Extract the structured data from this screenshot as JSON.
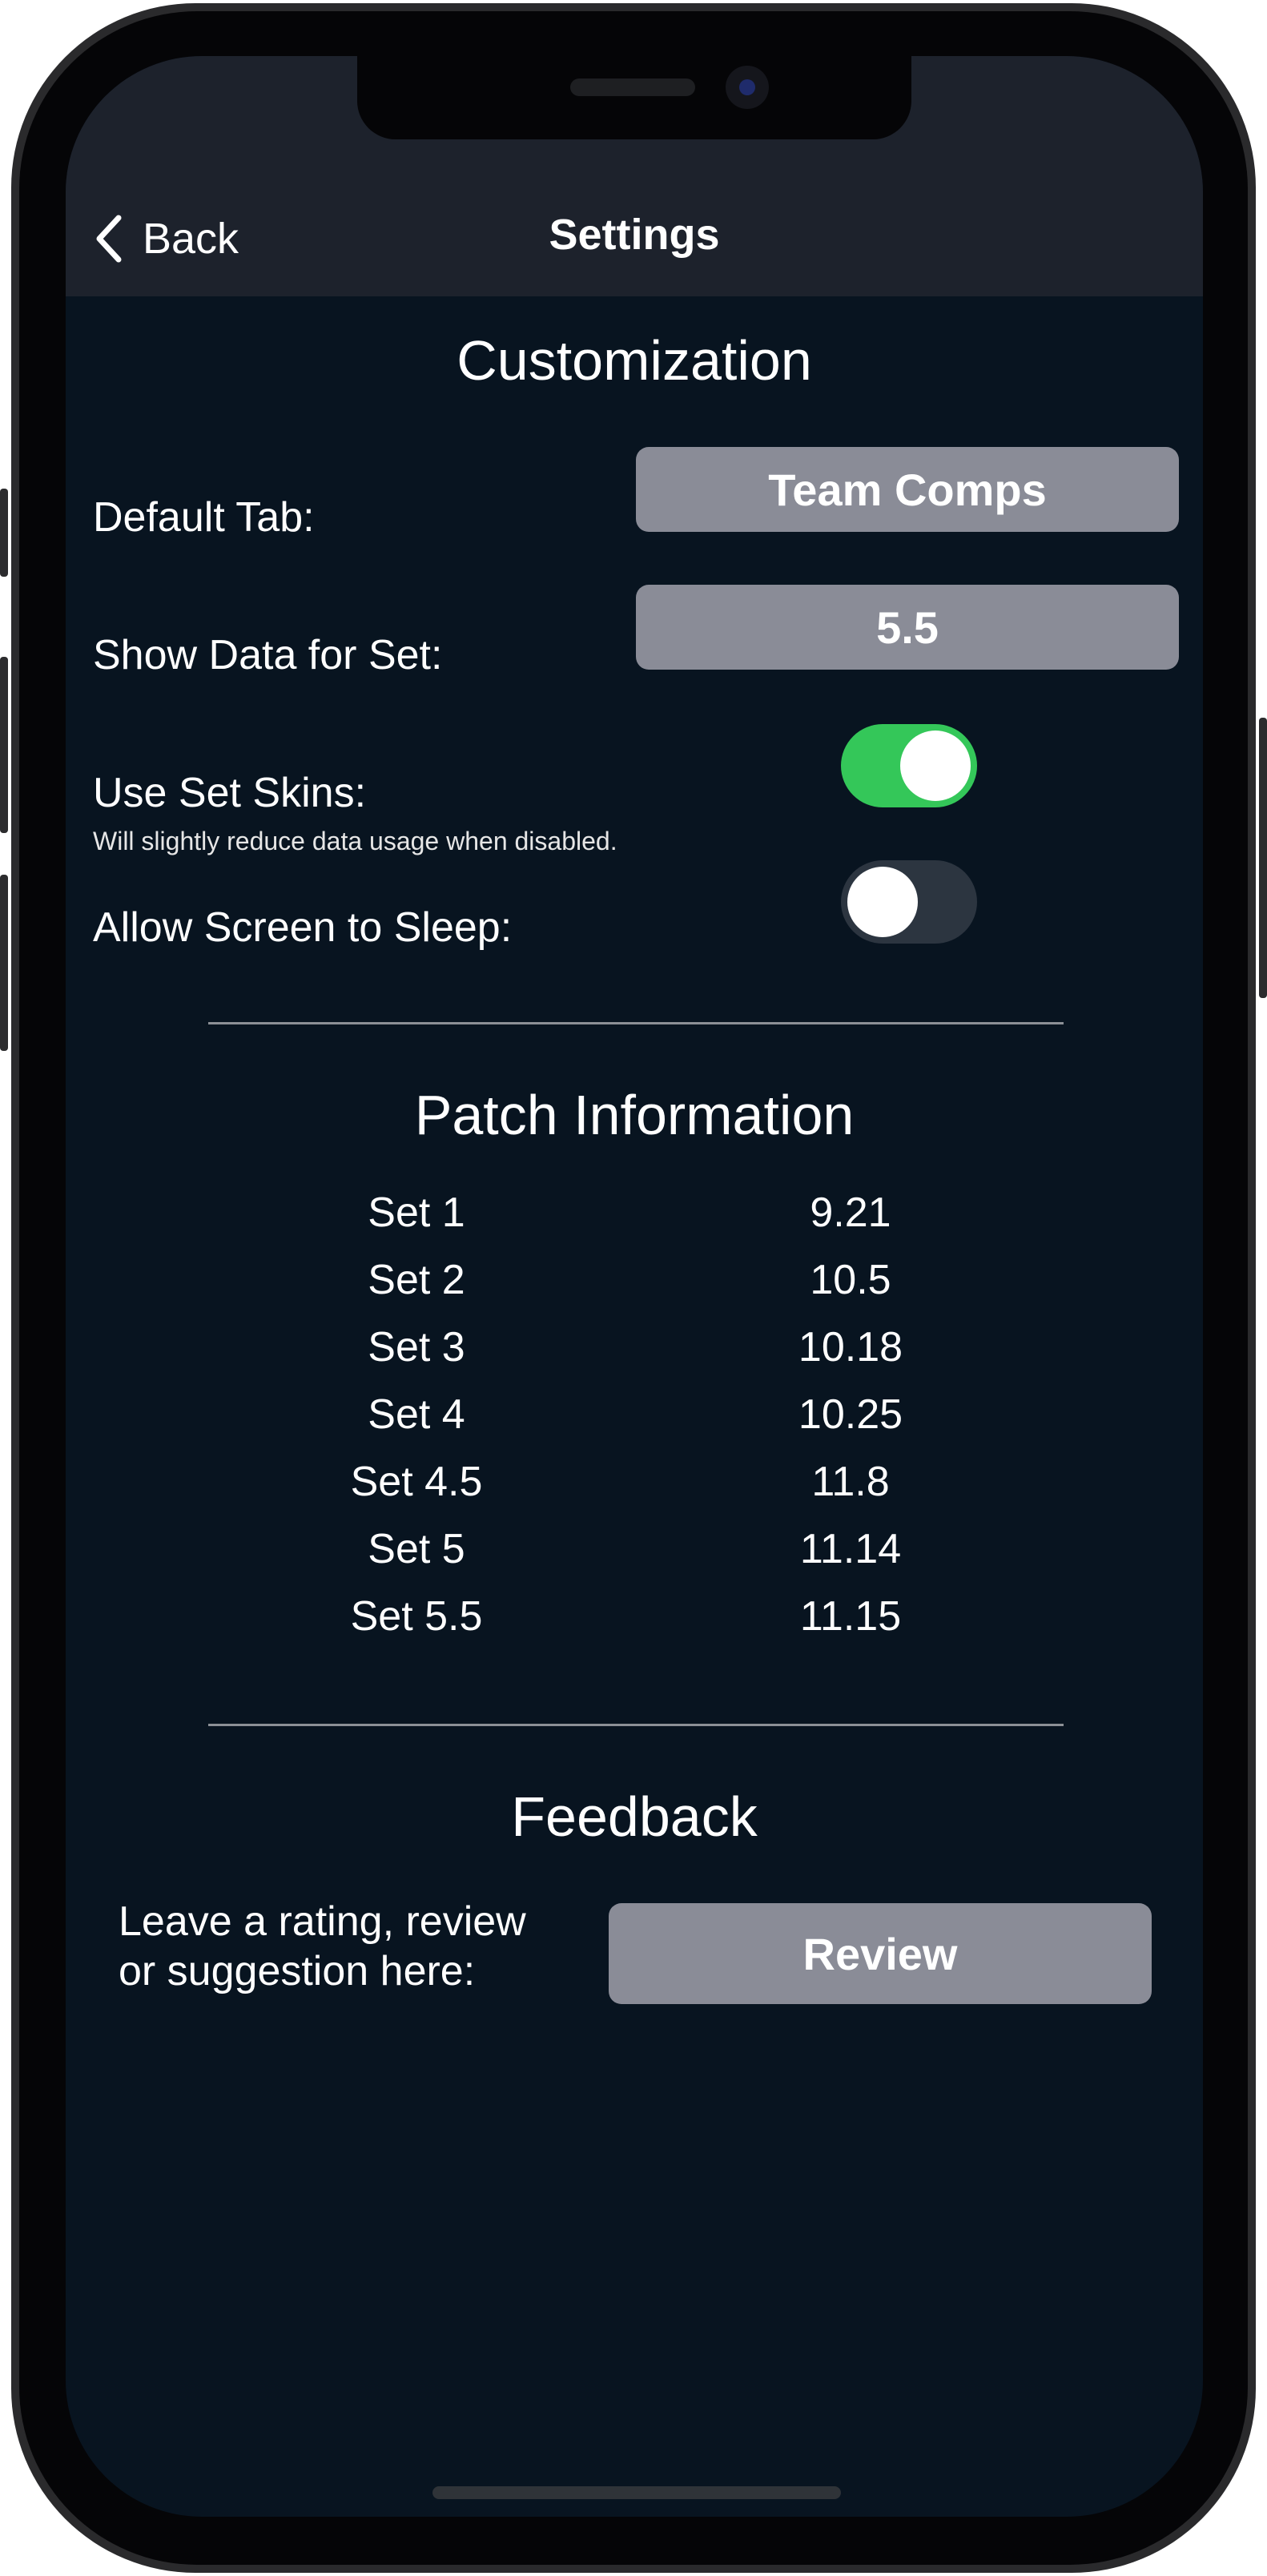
{
  "nav": {
    "back_label": "Back",
    "title": "Settings"
  },
  "customization": {
    "title": "Customization",
    "default_tab_label": "Default Tab:",
    "default_tab_value": "Team Comps",
    "show_data_label": "Show Data for Set:",
    "show_data_value": "5.5",
    "use_set_skins_label": "Use Set Skins:",
    "use_set_skins_note": "Will slightly reduce data usage when disabled.",
    "use_set_skins_on": true,
    "allow_sleep_label": "Allow Screen to Sleep:",
    "allow_sleep_on": false
  },
  "patch": {
    "title": "Patch Information",
    "rows": [
      {
        "set": "Set 1",
        "patch": "9.21"
      },
      {
        "set": "Set 2",
        "patch": "10.5"
      },
      {
        "set": "Set 3",
        "patch": "10.18"
      },
      {
        "set": "Set 4",
        "patch": "10.25"
      },
      {
        "set": "Set 4.5",
        "patch": "11.8"
      },
      {
        "set": "Set 5",
        "patch": "11.14"
      },
      {
        "set": "Set 5.5",
        "patch": "11.15"
      }
    ]
  },
  "feedback": {
    "title": "Feedback",
    "prompt_line1": "Leave a rating, review",
    "prompt_line2": "or suggestion here:",
    "review_label": "Review"
  },
  "colors": {
    "background": "#081420",
    "navbar": "#1d222c",
    "button_gray": "#8a8c97",
    "toggle_on": "#34c759",
    "toggle_off": "#2c3540"
  }
}
